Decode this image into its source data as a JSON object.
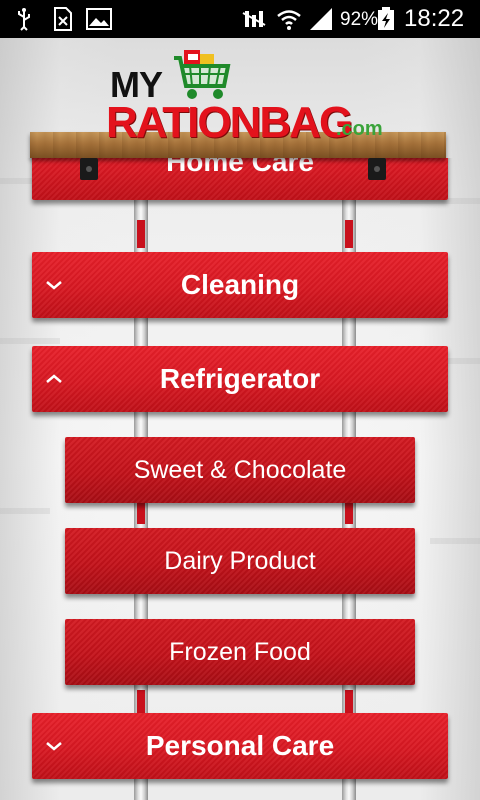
{
  "status_bar": {
    "battery_percent": "92%",
    "time": "18:22",
    "icons": [
      "usb-icon",
      "sim-icon",
      "gallery-icon",
      "mute-icon",
      "wifi-icon",
      "signal-icon",
      "battery-charging-icon"
    ]
  },
  "header": {
    "logo_my": "MY",
    "logo_ration": "RATIONBAG",
    "logo_com": ".com"
  },
  "menu": {
    "partial_top": "Home Care",
    "items": [
      {
        "label": "Cleaning",
        "expanded": false
      },
      {
        "label": "Refrigerator",
        "expanded": true
      },
      {
        "label": "Personal Care",
        "expanded": false
      }
    ],
    "sub_items": [
      "Sweet & Chocolate",
      "Dairy Product",
      "Frozen Food"
    ]
  },
  "colors": {
    "accent_red": "#d81822",
    "text": "#ffffff",
    "shelf_wood": "#a7743c"
  }
}
